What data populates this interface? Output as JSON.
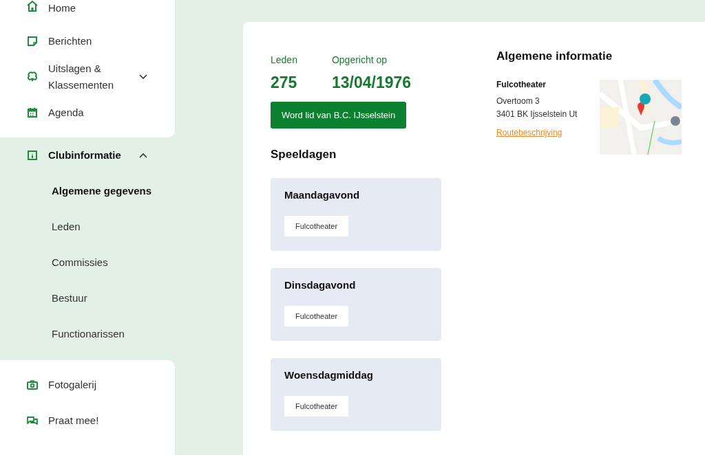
{
  "sidebar": {
    "items": [
      {
        "label": "Home",
        "selected": false
      },
      {
        "label": "Berichten",
        "selected": false
      },
      {
        "label": "Uitslagen & Klassementen",
        "selected": false,
        "expanded": false
      },
      {
        "label": "Agenda",
        "selected": false
      },
      {
        "label": "Clubinformatie",
        "selected": true,
        "expanded": true,
        "children": [
          {
            "label": "Algemene gegevens",
            "selected": true
          },
          {
            "label": "Leden",
            "selected": false
          },
          {
            "label": "Commissies",
            "selected": false
          },
          {
            "label": "Bestuur",
            "selected": false
          },
          {
            "label": "Functionarissen",
            "selected": false
          }
        ]
      },
      {
        "label": "Fotogalerij",
        "selected": false
      },
      {
        "label": "Praat mee!",
        "selected": false
      }
    ]
  },
  "stats": [
    {
      "label": "Leden",
      "value": "275"
    },
    {
      "label": "Opgericht op",
      "value": "13/04/1976"
    }
  ],
  "join_button": "Word lid van B.C. IJsselstein",
  "speeldagen": {
    "title": "Speeldagen",
    "days": [
      {
        "name": "Maandagavond",
        "location": "Fulcotheater"
      },
      {
        "name": "Dinsdagavond",
        "location": "Fulcotheater"
      },
      {
        "name": "Woensdagmiddag",
        "location": "Fulcotheater"
      }
    ]
  },
  "info": {
    "title": "Algemene informatie",
    "venue": "Fulcotheater",
    "address_lines": [
      "Overtoom 3",
      "3401 BK Ijsselstein Ut"
    ],
    "route_link": "Routebeschrijving"
  }
}
